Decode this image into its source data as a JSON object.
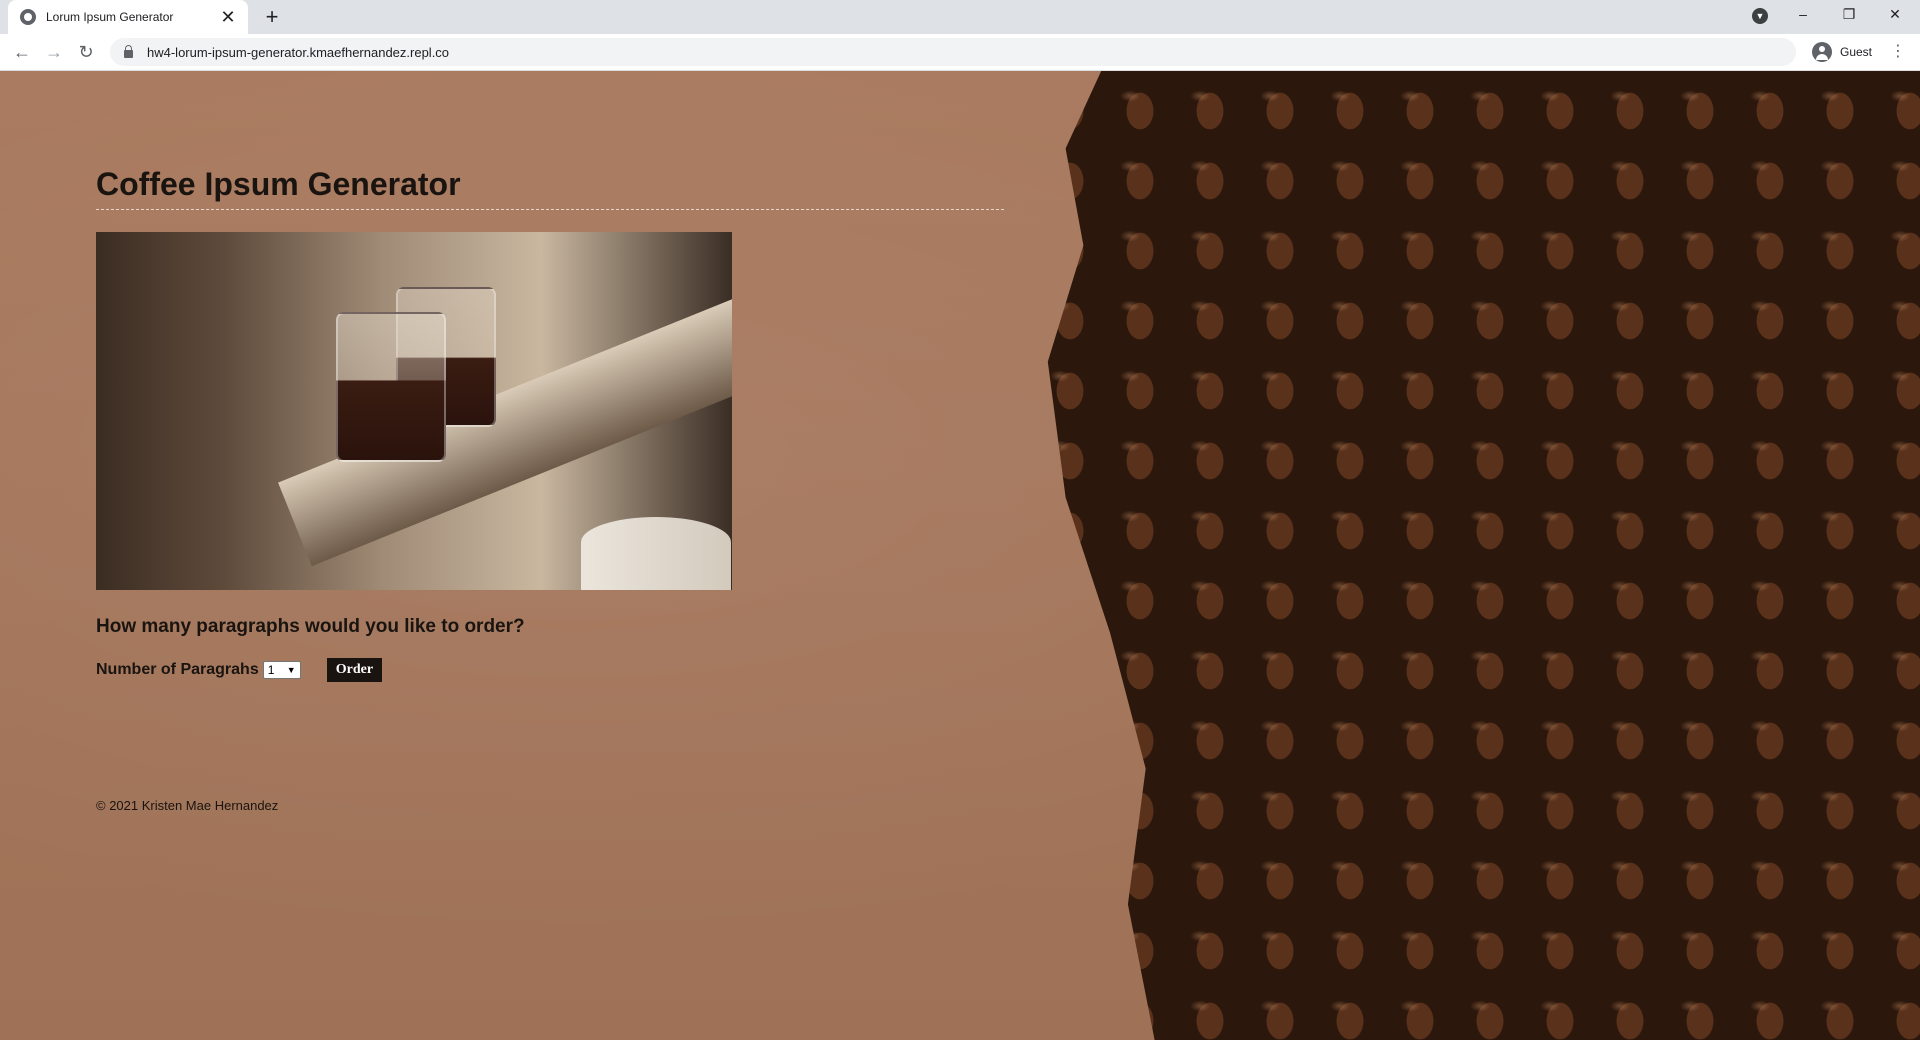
{
  "browser": {
    "tab_title": "Lorum Ipsum Generator",
    "tab_close": "✕",
    "new_tab": "+",
    "url": "hw4-lorum-ipsum-generator.kmaefhernandez.repl.co",
    "profile_label": "Guest",
    "icons": {
      "back": "←",
      "forward": "→",
      "reload": "↻",
      "menu": "⋮",
      "minimize": "–",
      "restore": "❐",
      "close": "✕",
      "tab_search": "▼"
    }
  },
  "page": {
    "title": "Coffee Ipsum Generator",
    "question": "How many paragraphs would you like to order?",
    "form": {
      "label": "Number of Paragrahs",
      "selected_value": "1",
      "button_label": "Order"
    },
    "footer": "© 2021 Kristen Mae Hernandez"
  }
}
